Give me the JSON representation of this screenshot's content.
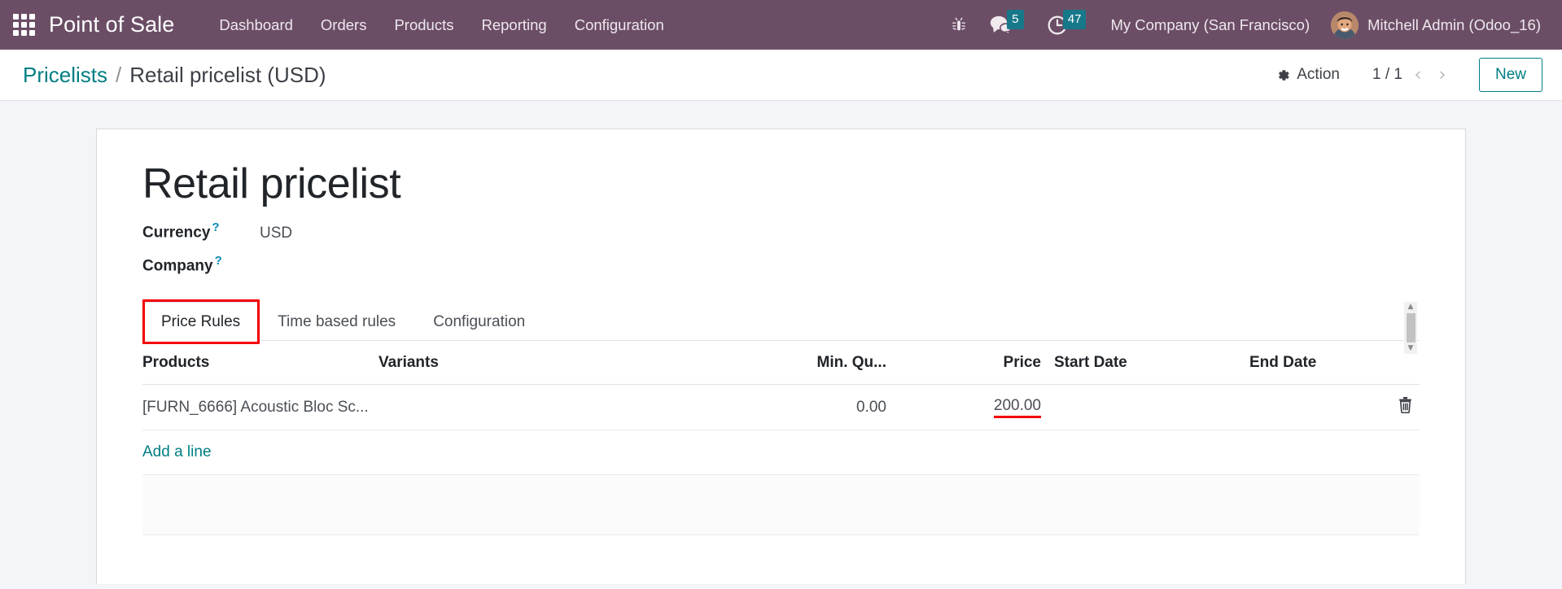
{
  "navbar": {
    "apps_icon": "apps-grid-icon",
    "brand": "Point of Sale",
    "menu": [
      {
        "label": "Dashboard"
      },
      {
        "label": "Orders"
      },
      {
        "label": "Products"
      },
      {
        "label": "Reporting"
      },
      {
        "label": "Configuration"
      }
    ],
    "systray": {
      "debug_icon": "bug-icon",
      "messages_icon": "chat-bubble-icon",
      "messages_count": "5",
      "activities_icon": "clock-icon",
      "activities_count": "47"
    },
    "company": "My Company (San Francisco)",
    "user": "Mitchell Admin (Odoo_16)",
    "avatar_icon": "user-avatar",
    "bg_color": "#6b4e66",
    "badge_color": "#17788a"
  },
  "control_panel": {
    "breadcrumb_root": "Pricelists",
    "breadcrumb_separator": "/",
    "breadcrumb_current": "Retail pricelist (USD)",
    "action_label": "Action",
    "action_icon": "gear-icon",
    "pager_value": "1 / 1",
    "pager_prev_icon": "chevron-left-icon",
    "pager_next_icon": "chevron-right-icon",
    "new_label": "New",
    "accent_color": "#017e84"
  },
  "form": {
    "title": "Retail pricelist",
    "fields": [
      {
        "label": "Currency",
        "tooltip": "?",
        "value": "USD"
      },
      {
        "label": "Company",
        "tooltip": "?",
        "value": ""
      }
    ]
  },
  "notebook": {
    "tabs": [
      {
        "label": "Price Rules",
        "active": true,
        "highlighted": true
      },
      {
        "label": "Time based rules",
        "active": false,
        "highlighted": false
      },
      {
        "label": "Configuration",
        "active": false,
        "highlighted": false
      }
    ],
    "highlight_color": "#f40000"
  },
  "price_rules": {
    "columns": [
      {
        "label": "Products",
        "align": "left"
      },
      {
        "label": "Variants",
        "align": "left"
      },
      {
        "label": "Min. Qu...",
        "align": "right"
      },
      {
        "label": "Price",
        "align": "right"
      },
      {
        "label": "Start Date",
        "align": "left"
      },
      {
        "label": "End Date",
        "align": "left"
      }
    ],
    "rows": [
      {
        "product": "[FURN_6666] Acoustic Bloc Sc...",
        "variants": "",
        "min_quantity": "0.00",
        "price": "200.00",
        "price_highlighted": true,
        "start_date": "",
        "end_date": "",
        "delete_icon": "trash-icon"
      }
    ],
    "add_line_label": "Add a line"
  },
  "scrollbar": {
    "up_icon": "scroll-up-arrow",
    "down_icon": "scroll-down-arrow"
  }
}
